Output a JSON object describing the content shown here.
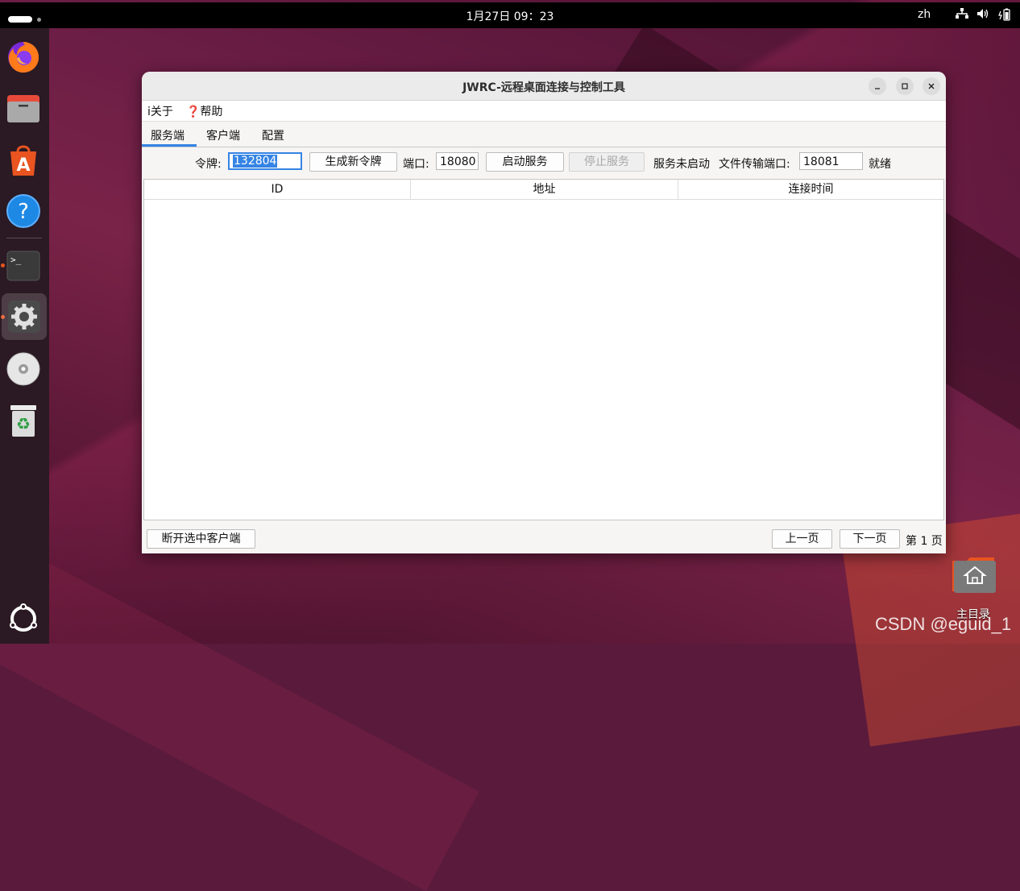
{
  "topbar": {
    "clock": "1月27日  09：23",
    "lang": "zh",
    "tray_icons": [
      "network-icon",
      "volume-icon",
      "battery-icon"
    ]
  },
  "dock": {
    "items": [
      "firefox",
      "files",
      "app-center",
      "help",
      "terminal",
      "settings",
      "disc",
      "trash",
      "show-apps"
    ]
  },
  "desktop": {
    "home_label": "主目录",
    "watermark": "CSDN @eguid_1"
  },
  "window": {
    "title": "JWRC-远程桌面连接与控制工具",
    "menu": {
      "about": "i关于",
      "help": "❓帮助"
    },
    "tabs": [
      "服务端",
      "客户端",
      "配置"
    ],
    "active_tab": 0,
    "toolbar": {
      "token_label": "令牌:",
      "token_value": "132804",
      "gen_token_button": "生成新令牌",
      "port_label": "端口:",
      "port_value": "18080",
      "start_button": "启动服务",
      "stop_button": "停止服务",
      "service_status": "服务未启动",
      "file_port_label": "文件传输端口:",
      "file_port_value": "18081",
      "ready_status": "就绪"
    },
    "table": {
      "columns": [
        "ID",
        "地址",
        "连接时间"
      ],
      "rows": []
    },
    "footer": {
      "disconnect_button": "断开选中客户端",
      "prev_button": "上一页",
      "next_button": "下一页",
      "page_info": "第 1 页"
    }
  }
}
